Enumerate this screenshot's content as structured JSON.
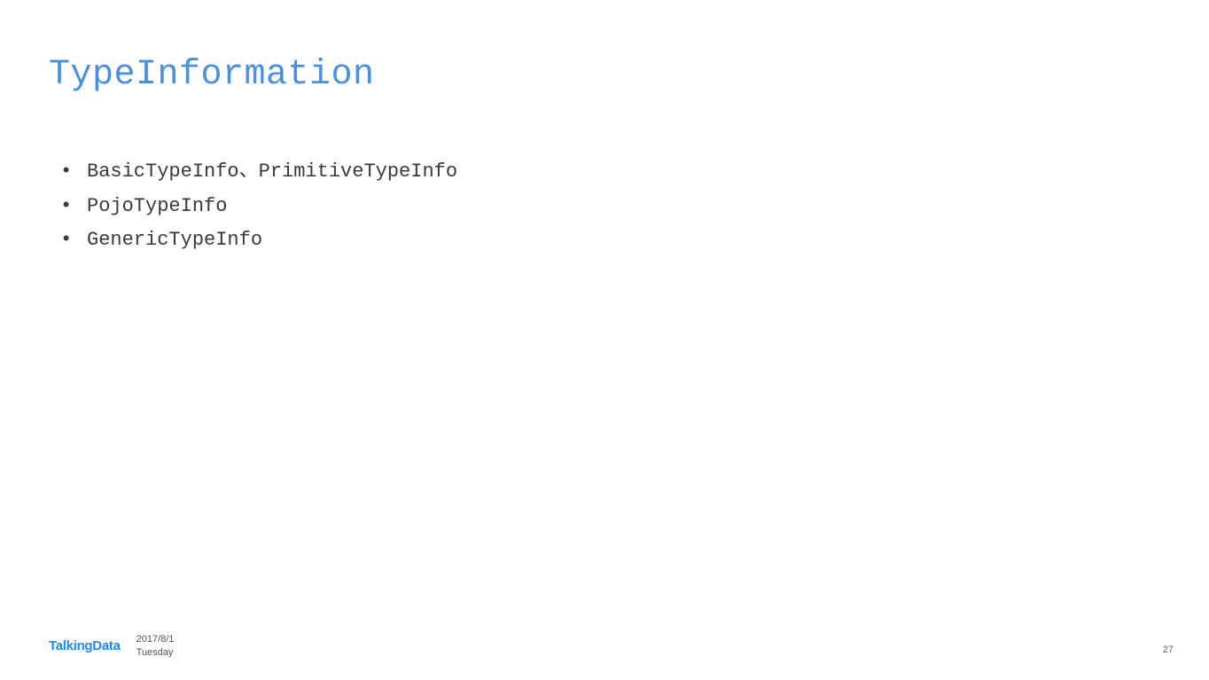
{
  "title": "TypeInformation",
  "bullets": [
    "BasicTypeInfo、PrimitiveTypeInfo",
    "PojoTypeInfo",
    "GenericTypeInfo"
  ],
  "footer": {
    "logo": "TalkingData",
    "date": "2017/8/1",
    "day": "Tuesday"
  },
  "pageNumber": "27"
}
